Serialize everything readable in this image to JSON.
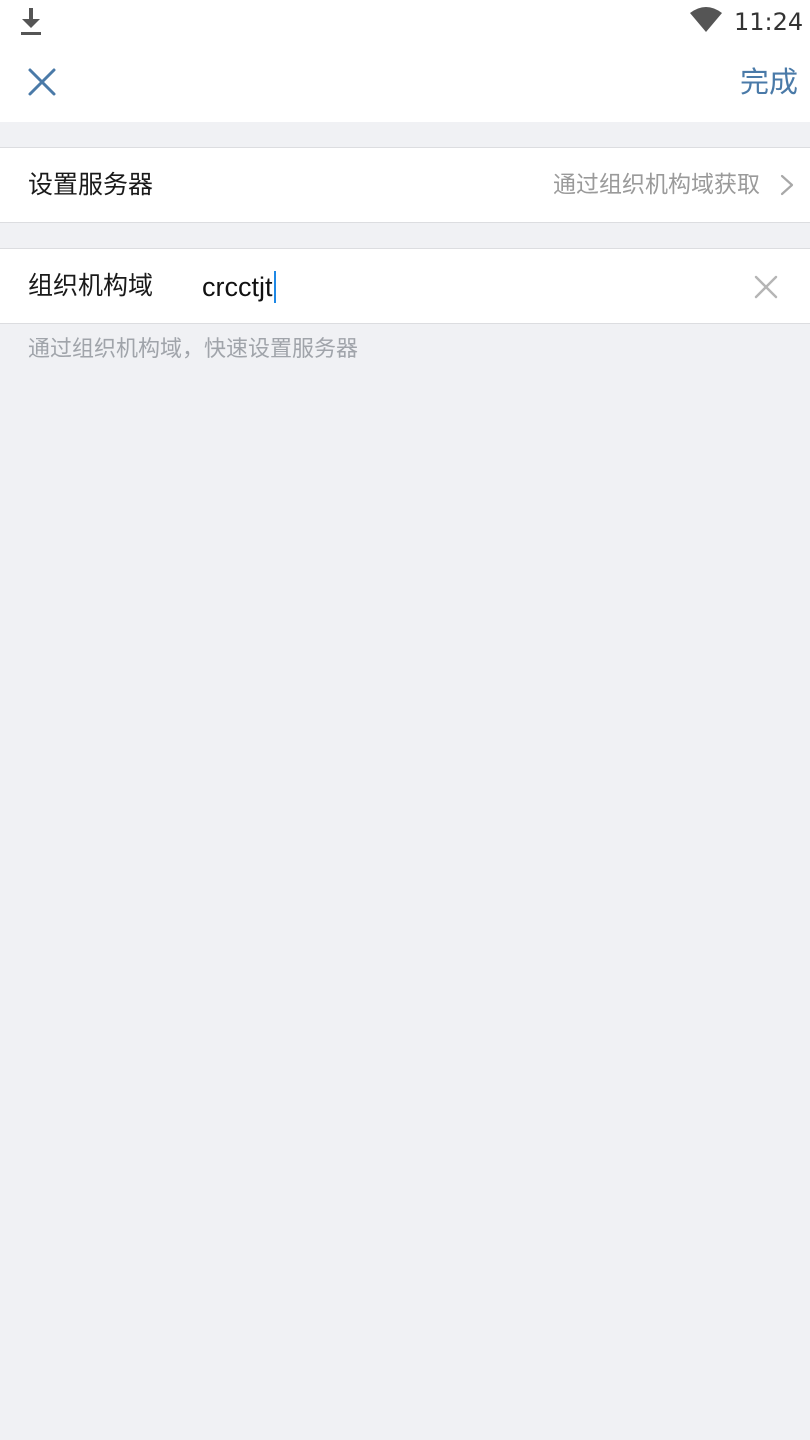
{
  "status_bar": {
    "time": "11:24",
    "icons": [
      "download-icon",
      "wifi-icon"
    ]
  },
  "nav": {
    "close_icon": "close-icon",
    "done_label": "完成",
    "accent_color": "#4a7aa8"
  },
  "server_row": {
    "label": "设置服务器",
    "value": "通过组织机构域获取",
    "icon": "chevron-right-icon"
  },
  "domain_row": {
    "label": "组织机构域",
    "input_value": "crcctjt",
    "icon": "clear-icon"
  },
  "hint": "通过组织机构域，快速设置服务器"
}
